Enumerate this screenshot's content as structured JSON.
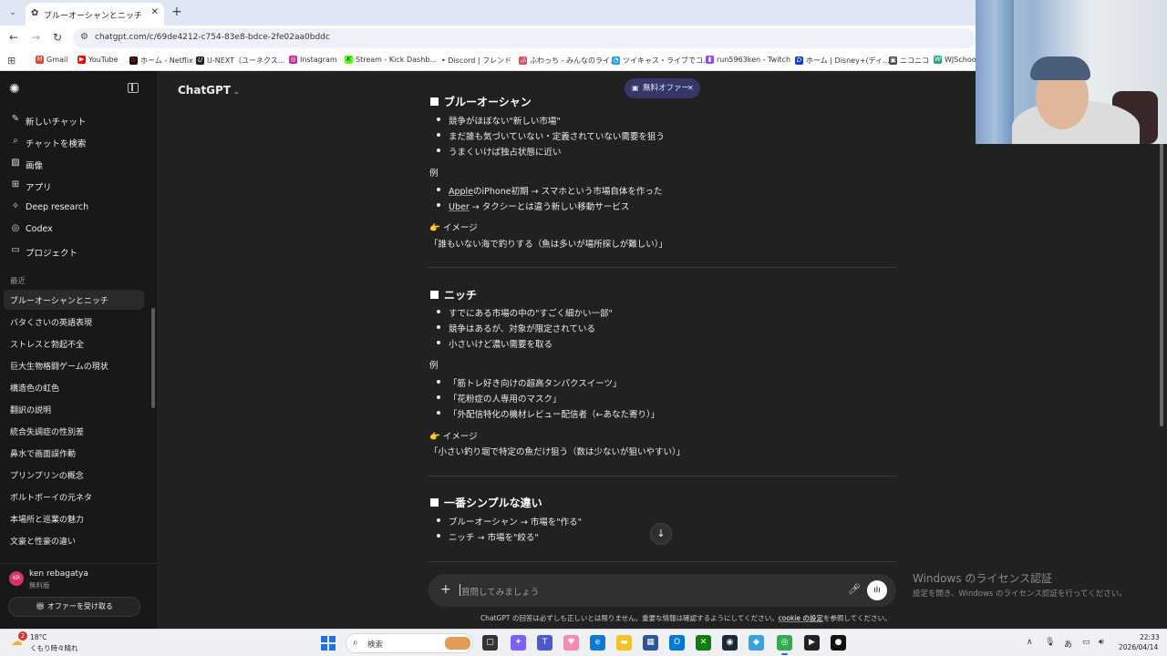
{
  "browser": {
    "tab_title": "ブルーオーシャンとニッチ",
    "url": "chatgpt.com/c/69de4212-c754-83e8-bdce-2fe02aa0bddc",
    "bookmarks": [
      "Gmail",
      "YouTube",
      "ホーム - Netflix",
      "U-NEXT（ユーネクス...",
      "Instagram",
      "Stream - Kick Dashb...",
      "• Discord | フレンド",
      "ふわっち - みんなのライ...",
      "ツイキャス・ライブでコ...",
      "run5963ken - Twitch",
      "ホーム | Disney+(ディ...",
      "ニコニコ",
      "WJSchoo"
    ]
  },
  "sidebar": {
    "nav": [
      {
        "label": "新しいチャット",
        "icon": "edit-icon"
      },
      {
        "label": "チャットを検索",
        "icon": "search-icon"
      },
      {
        "label": "画像",
        "icon": "image-icon"
      },
      {
        "label": "アプリ",
        "icon": "apps-icon"
      },
      {
        "label": "Deep research",
        "icon": "deep-research-icon"
      },
      {
        "label": "Codex",
        "icon": "codex-icon"
      },
      {
        "label": "プロジェクト",
        "icon": "folder-icon"
      }
    ],
    "recent_label": "最近",
    "history": [
      "ブルーオーシャンとニッチ",
      "バタくさいの英語表現",
      "ストレスと勃起不全",
      "巨大生物格闘ゲームの現状",
      "構造色の虹色",
      "翻訳の説明",
      "統合失調症の性別差",
      "鼻水で画面誤作動",
      "プリンプリンの概念",
      "ボルトボーイの元ネタ",
      "本場所と巡業の魅力",
      "文豪と性豪の違い"
    ],
    "user": {
      "initials": "KR",
      "name": "ken rebagatya",
      "plan": "無料版"
    },
    "offer_button": "オファーを受け取る"
  },
  "main": {
    "model": "ChatGPT",
    "free_offer": "無料オファー",
    "sections": [
      {
        "heading": "ブルーオーシャン",
        "bullets": [
          "競争がほぼない\"新しい市場\"",
          "まだ誰も気づいていない・定義されていない需要を狙う",
          "うまくいけば独占状態に近い"
        ],
        "example_label": "例",
        "examples": [
          {
            "u": "Apple",
            "rest": "のiPhone初期 → スマホという市場自体を作った"
          },
          {
            "u": "Uber",
            "rest": " → タクシーとは違う新しい移動サービス"
          }
        ],
        "image_label": "👉 イメージ",
        "image_text": "「誰もいない海で釣りする（魚は多いが場所探しが難しい）」"
      },
      {
        "heading": "ニッチ",
        "bullets": [
          "すでにある市場の中の\"すごく細かい一部\"",
          "競争はあるが、対象が限定されている",
          "小さいけど濃い需要を取る"
        ],
        "example_label": "例",
        "examples": [
          "「筋トレ好き向けの超高タンパクスイーツ」",
          "「花粉症の人専用のマスク」",
          "「外配信特化の機材レビュー配信者（←あなた寄り）」"
        ],
        "image_label": "👉 イメージ",
        "image_text": "「小さい釣り堀で特定の魚だけ狙う（数は少ないが狙いやすい）」"
      },
      {
        "heading": "一番シンプルな違い",
        "bullets": [
          "ブルーオーシャン → 市場を\"作る\"",
          "ニッチ → 市場を\"絞る\""
        ]
      }
    ],
    "composer_placeholder": "質問してみましょう",
    "disclaimer_pre": "ChatGPT の回答は必ずしも正しいとは限りません。重要な情報は確認するようにしてください。",
    "disclaimer_link": "cookie の設定",
    "disclaimer_post": "を参照してください。"
  },
  "windows_activation": {
    "title": "Windows のライセンス認証",
    "subtitle": "設定を開き、Windows のライセンス認証を行ってください。"
  },
  "taskbar": {
    "weather_badge": "2",
    "temp": "18°C",
    "weather": "くもり時々晴れ",
    "search": "検索",
    "time": "22:33",
    "date": "2026/04/14"
  }
}
